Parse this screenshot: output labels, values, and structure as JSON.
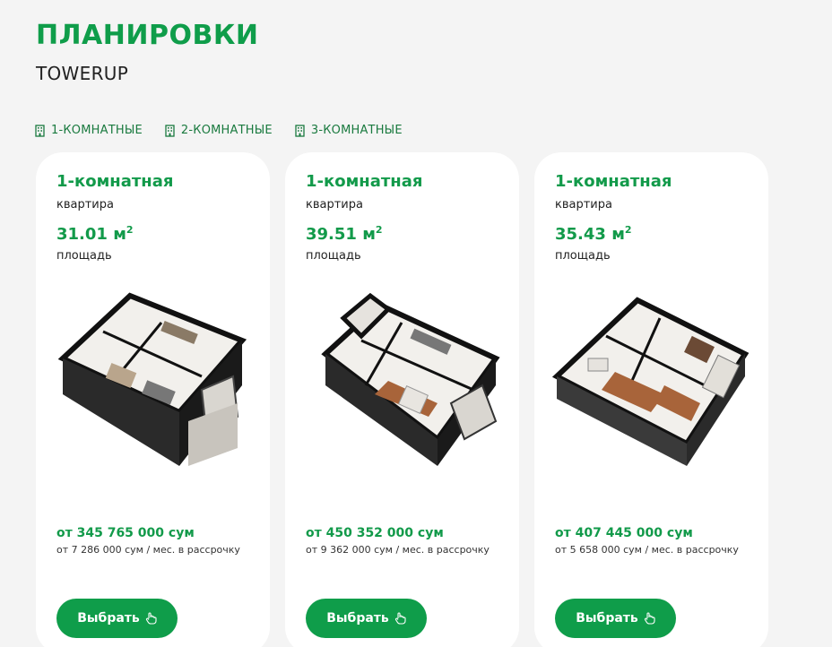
{
  "header": {
    "title": "ПЛАНИРОВКИ",
    "subtitle": "TOWERUP"
  },
  "filters": [
    {
      "label": "1-КОМНАТНЫЕ",
      "icon": "building-icon"
    },
    {
      "label": "2-КОМНАТНЫЕ",
      "icon": "building-icon"
    },
    {
      "label": "3-КОМНАТНЫЕ",
      "icon": "building-icon"
    }
  ],
  "cards": [
    {
      "type": "1-комнатная",
      "type_sub": "квартира",
      "area": "31.01 м",
      "area_sup": "2",
      "area_sub": "площадь",
      "price": "от 345 765 000 сум",
      "installment": "от 7 286 000 сум / мес. в рассрочку",
      "button": "Выбрать"
    },
    {
      "type": "1-комнатная",
      "type_sub": "квартира",
      "area": "39.51 м",
      "area_sup": "2",
      "area_sub": "площадь",
      "price": "от 450 352 000 сум",
      "installment": "от 9 362 000 сум / мес. в рассрочку",
      "button": "Выбрать"
    },
    {
      "type": "1-комнатная",
      "type_sub": "квартира",
      "area": "35.43 м",
      "area_sup": "2",
      "area_sub": "площадь",
      "price": "от 407 445 000 сум",
      "installment": "от 5 658 000 сум / мес. в рассрочку",
      "button": "Выбрать"
    }
  ],
  "colors": {
    "accent": "#0f9d4a",
    "background": "#f4f4f4",
    "card": "#ffffff"
  }
}
